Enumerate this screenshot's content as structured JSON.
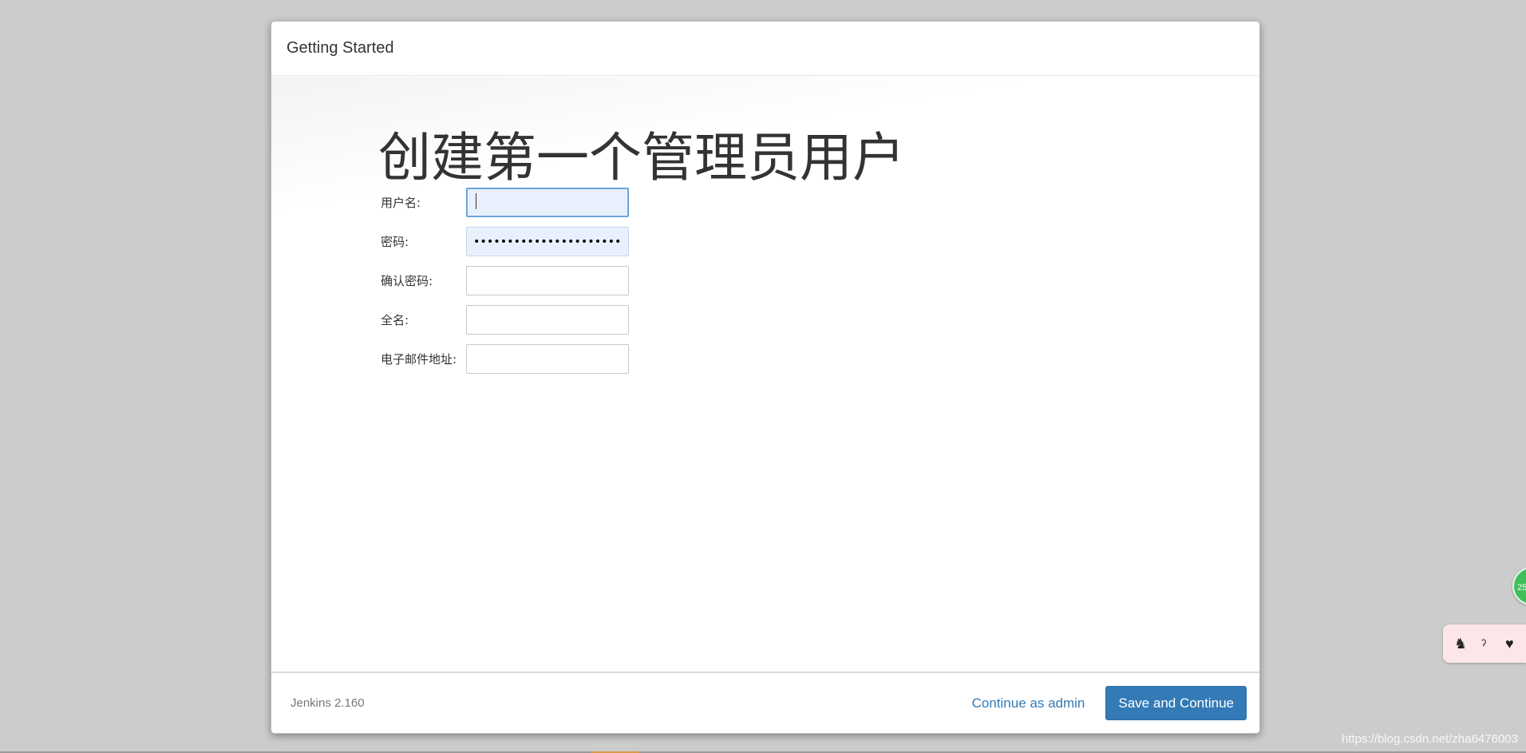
{
  "dialog": {
    "title": "Getting Started",
    "heading": "创建第一个管理员用户"
  },
  "form": {
    "fields": [
      {
        "label": "用户名:",
        "value": "",
        "state": "focused"
      },
      {
        "label": "密码:",
        "value": "••••••••••••••••••••••••••••••••",
        "state": "filled"
      },
      {
        "label": "确认密码:",
        "value": "",
        "state": "empty"
      },
      {
        "label": "全名:",
        "value": "",
        "state": "empty"
      },
      {
        "label": "电子邮件地址:",
        "value": "",
        "state": "empty"
      }
    ]
  },
  "footer": {
    "version": "Jenkins 2.160",
    "continue_label": "Continue as admin",
    "save_label": "Save and Continue"
  },
  "overlay": {
    "watermark": "https://blog.csdn.net/zha6476003",
    "float_ball_text": "25"
  },
  "colors": {
    "primary": "#337ab7",
    "backdrop": "#cccccc"
  }
}
